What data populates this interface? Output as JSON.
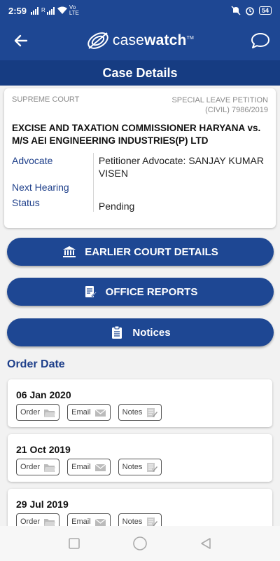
{
  "status": {
    "time": "2:59",
    "net": "R",
    "volte": "Vo LTE",
    "battery": "54"
  },
  "app": {
    "logo_light": "case",
    "logo_bold": "watch",
    "tm": "TM"
  },
  "header": {
    "title": "Case Details"
  },
  "case": {
    "court": "SUPREME COURT",
    "type_line1": "SPECIAL LEAVE PETITION",
    "type_line2": "(CIVIL) 7986/2019",
    "parties": "EXCISE AND TAXATION COMMISSIONER HARYANA vs. M/S AEI ENGINEERING INDUSTRIES(P) LTD",
    "labels": {
      "advocate": "Advocate",
      "next_hearing": "Next Hearing",
      "status": "Status"
    },
    "advocate": "Petitioner Advocate: SANJAY KUMAR VISEN",
    "next_hearing": "",
    "status": "Pending"
  },
  "buttons": {
    "earlier": "EARLIER COURT DETAILS",
    "office": "OFFICE REPORTS",
    "notices": "Notices"
  },
  "orders": {
    "heading": "Order Date",
    "chip_labels": {
      "order": "Order",
      "email": "Email",
      "notes": "Notes"
    },
    "items": [
      {
        "date": "06 Jan 2020"
      },
      {
        "date": "21 Oct 2019"
      },
      {
        "date": "29 Jul 2019"
      }
    ]
  },
  "colors": {
    "primary": "#1e4793",
    "title_bar": "#163c82",
    "label_blue": "#1e3f8a"
  },
  "icons": [
    "back-arrow-icon",
    "chat-bubble-icon",
    "bank-icon",
    "report-icon",
    "clipboard-icon",
    "folder-icon",
    "mail-icon",
    "notes-icon"
  ]
}
